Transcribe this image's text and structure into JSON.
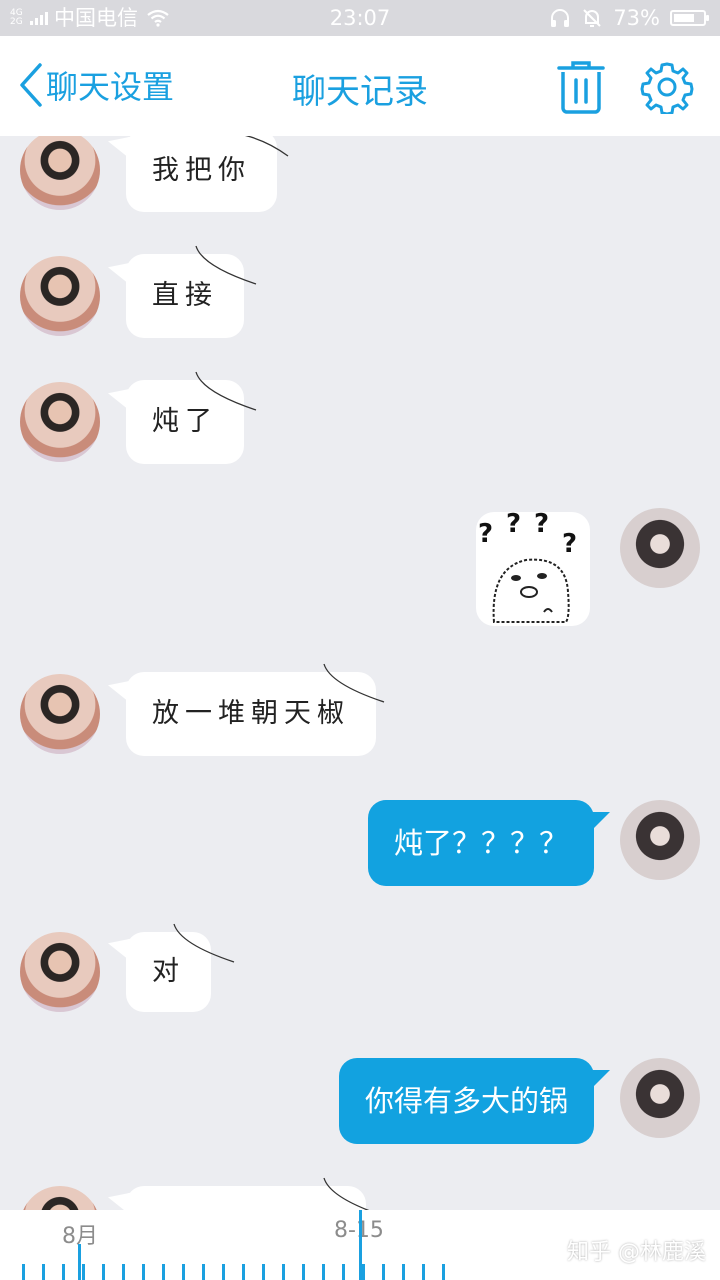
{
  "status_bar": {
    "network": "4G 2G",
    "carrier": "中国电信",
    "time": "23:07",
    "battery": "73%",
    "battery_level": 0.73
  },
  "header": {
    "back_label": "聊天设置",
    "title": "聊天记录",
    "accent": "#1aa0e0"
  },
  "messages": [
    {
      "side": "incoming",
      "text": "我把你"
    },
    {
      "side": "incoming",
      "text": "直接"
    },
    {
      "side": "incoming",
      "text": "炖了"
    },
    {
      "side": "outgoing",
      "type": "sticker",
      "sticker": "question-marks-bear"
    },
    {
      "side": "incoming",
      "text": "放一堆朝天椒"
    },
    {
      "side": "outgoing",
      "text": "炖了？？？？"
    },
    {
      "side": "incoming",
      "text": "对"
    },
    {
      "side": "outgoing",
      "text": "你得有多大的锅"
    },
    {
      "side": "incoming",
      "text": ""
    }
  ],
  "timeline": {
    "month_label": "8月",
    "date_label": "8-15"
  },
  "watermark": "知乎 @林鹿溪",
  "colors": {
    "outgoing_bubble": "#12a2e0",
    "incoming_bubble": "#ffffff",
    "background": "#ecedf1"
  }
}
